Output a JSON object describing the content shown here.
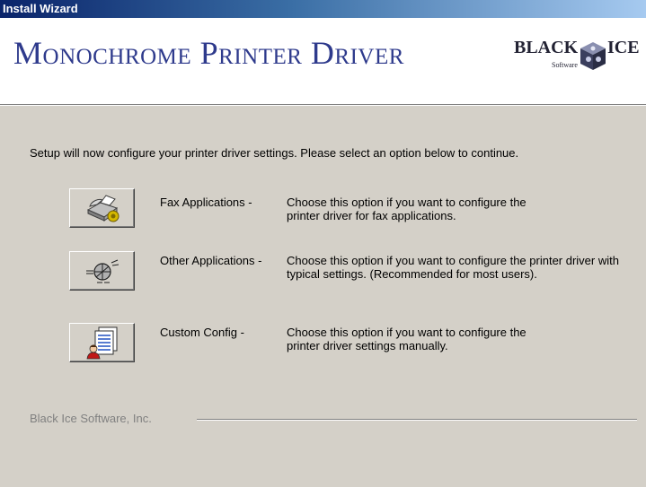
{
  "window": {
    "title": "Install Wizard"
  },
  "header": {
    "product_title": "Monochrome Printer Driver",
    "logo": {
      "text_left": "BLACK",
      "text_right": "ICE",
      "sub": "Software"
    }
  },
  "intro_text": "Setup will now configure your printer driver settings. Please select an option below to continue.",
  "options": [
    {
      "label": "Fax Applications -",
      "description": "Choose this option if you want to configure the printer driver for fax applications.",
      "icon": "fax-icon"
    },
    {
      "label": "Other Applications -",
      "description": "Choose this option if you want to configure the printer driver with typical settings. (Recommended for most users).",
      "icon": "settings-dial-icon"
    },
    {
      "label": "Custom Config -",
      "description": "Choose this option if you want to configure the printer driver settings manually.",
      "icon": "user-document-icon"
    }
  ],
  "footer": {
    "company": "Black Ice Software, Inc."
  }
}
